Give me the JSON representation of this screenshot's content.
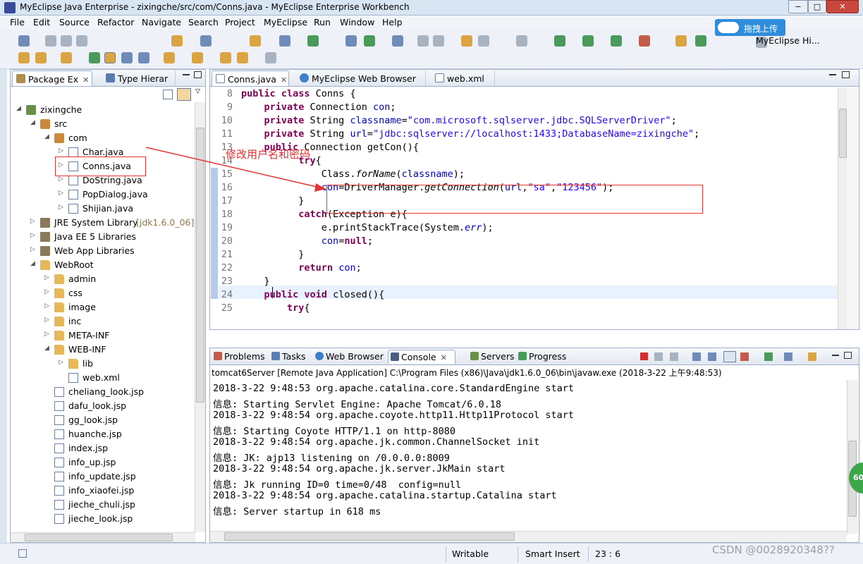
{
  "window": {
    "title": "MyEclipse Java Enterprise - zixingche/src/com/Conns.java - MyEclipse Enterprise Workbench",
    "minimize": "−",
    "maximize": "□",
    "close": "✕"
  },
  "menu": [
    "File",
    "Edit",
    "Source",
    "Refactor",
    "Navigate",
    "Search",
    "Project",
    "MyEclipse",
    "Run",
    "Window",
    "Help"
  ],
  "baidu_widget": {
    "label": "拖拽上传"
  },
  "perspective_hint": "MyEclipse Hi...",
  "left_panel": {
    "tabs": [
      {
        "label": "Package Ex",
        "close": "✕"
      },
      {
        "label": "Type Hierar"
      }
    ],
    "tree": [
      {
        "label": "zixingche",
        "icon": "project-icon",
        "twisty": "◢"
      },
      {
        "label": "src",
        "icon": "source-folder-icon",
        "twisty": "◢"
      },
      {
        "label": "com",
        "icon": "package-icon",
        "twisty": "◢"
      },
      {
        "label": "Char.java",
        "icon": "java-file-icon",
        "twisty": "▷"
      },
      {
        "label": "Conns.java",
        "icon": "java-file-icon",
        "twisty": "▷"
      },
      {
        "label": "DoString.java",
        "icon": "java-file-icon",
        "twisty": "▷"
      },
      {
        "label": "PopDialog.java",
        "icon": "java-file-icon",
        "twisty": "▷"
      },
      {
        "label": "Shijian.java",
        "icon": "java-file-icon",
        "twisty": "▷"
      },
      {
        "label": "JRE System Library",
        "extra": "[jdk1.6.0_06]",
        "icon": "library-icon",
        "twisty": "▷"
      },
      {
        "label": "Java EE 5 Libraries",
        "icon": "library-icon",
        "twisty": "▷"
      },
      {
        "label": "Web App Libraries",
        "icon": "library-icon",
        "twisty": "▷"
      },
      {
        "label": "WebRoot",
        "icon": "webroot-icon",
        "twisty": "◢"
      },
      {
        "label": "admin",
        "icon": "folder-icon",
        "twisty": "▷"
      },
      {
        "label": "css",
        "icon": "folder-icon",
        "twisty": "▷"
      },
      {
        "label": "image",
        "icon": "folder-icon",
        "twisty": "▷"
      },
      {
        "label": "inc",
        "icon": "folder-icon",
        "twisty": "▷"
      },
      {
        "label": "META-INF",
        "icon": "folder-icon",
        "twisty": "▷"
      },
      {
        "label": "WEB-INF",
        "icon": "folder-icon",
        "twisty": "◢"
      },
      {
        "label": "lib",
        "icon": "folder-icon",
        "twisty": "▷"
      },
      {
        "label": "web.xml",
        "icon": "xml-file-icon",
        "twisty": ""
      },
      {
        "label": "cheliang_look.jsp",
        "icon": "jsp-file-icon",
        "twisty": ""
      },
      {
        "label": "dafu_look.jsp",
        "icon": "jsp-file-icon",
        "twisty": ""
      },
      {
        "label": "gg_look.jsp",
        "icon": "jsp-file-icon",
        "twisty": ""
      },
      {
        "label": "huanche.jsp",
        "icon": "jsp-file-icon",
        "twisty": ""
      },
      {
        "label": "index.jsp",
        "icon": "jsp-file-icon",
        "twisty": ""
      },
      {
        "label": "info_up.jsp",
        "icon": "jsp-file-icon",
        "twisty": ""
      },
      {
        "label": "info_update.jsp",
        "icon": "jsp-file-icon",
        "twisty": ""
      },
      {
        "label": "info_xiaofei.jsp",
        "icon": "jsp-file-icon",
        "twisty": ""
      },
      {
        "label": "jieche_chuli.jsp",
        "icon": "jsp-file-icon",
        "twisty": ""
      },
      {
        "label": "jieche_look.jsp",
        "icon": "jsp-file-icon",
        "twisty": ""
      }
    ]
  },
  "editor": {
    "tabs": [
      {
        "label": "Conns.java",
        "close": "✕"
      },
      {
        "label": "MyEclipse Web Browser"
      },
      {
        "label": "web.xml"
      }
    ],
    "lines": [
      {
        "n": "8",
        "parts": [
          [
            "kw",
            "public class "
          ],
          [
            "",
            "Conns {"
          ]
        ]
      },
      {
        "n": "9",
        "parts": [
          [
            "",
            "    "
          ],
          [
            "kw",
            "private "
          ],
          [
            "",
            "Connection "
          ],
          [
            "fd",
            "con"
          ],
          [
            "",
            ";"
          ]
        ]
      },
      {
        "n": "10",
        "parts": [
          [
            "",
            "    "
          ],
          [
            "kw",
            "private "
          ],
          [
            "",
            "String "
          ],
          [
            "fd",
            "classname"
          ],
          [
            "",
            "="
          ],
          [
            "st",
            "\"com.microsoft.sqlserver.jdbc.SQLServerDriver\""
          ],
          [
            "",
            ";"
          ]
        ]
      },
      {
        "n": "11",
        "parts": [
          [
            "",
            "    "
          ],
          [
            "kw",
            "private "
          ],
          [
            "",
            "String "
          ],
          [
            "fd",
            "url"
          ],
          [
            "",
            "="
          ],
          [
            "st",
            "\"jdbc:sqlserver://localhost:1433;DatabaseName=zixingche\""
          ],
          [
            "",
            ";"
          ]
        ]
      },
      {
        "n": "13",
        "parts": [
          [
            "",
            "    "
          ],
          [
            "kw",
            "public "
          ],
          [
            "",
            "Connection getCon(){"
          ]
        ]
      },
      {
        "n": "14",
        "parts": [
          [
            "",
            "          "
          ],
          [
            "kw",
            "try"
          ],
          [
            "",
            "{"
          ]
        ]
      },
      {
        "n": "15",
        "parts": [
          [
            "",
            "              Class."
          ],
          [
            "it",
            "forName"
          ],
          [
            "",
            "("
          ],
          [
            "fd",
            "classname"
          ],
          [
            "",
            ");"
          ]
        ]
      },
      {
        "n": "16",
        "parts": [
          [
            "",
            "              "
          ],
          [
            "fd",
            "con"
          ],
          [
            "",
            "=DriverManager."
          ],
          [
            "it",
            "getConnection"
          ],
          [
            "",
            "("
          ],
          [
            "fd",
            "url"
          ],
          [
            "",
            ","
          ],
          [
            "st",
            "\"sa\""
          ],
          [
            "",
            ","
          ],
          [
            "st",
            "\"123456\""
          ],
          [
            "",
            ");"
          ]
        ]
      },
      {
        "n": "17",
        "parts": [
          [
            "",
            "          }"
          ]
        ]
      },
      {
        "n": "18",
        "parts": [
          [
            "",
            "          "
          ],
          [
            "kw",
            "catch"
          ],
          [
            "",
            "(Exception e){"
          ]
        ]
      },
      {
        "n": "19",
        "parts": [
          [
            "",
            "              e.printStackTrace(System."
          ],
          [
            "fd it",
            "err"
          ],
          [
            "",
            ");"
          ]
        ]
      },
      {
        "n": "20",
        "parts": [
          [
            "",
            "              "
          ],
          [
            "fd",
            "con"
          ],
          [
            "",
            "="
          ],
          [
            "kw",
            "null"
          ],
          [
            "",
            ";"
          ]
        ]
      },
      {
        "n": "21",
        "parts": [
          [
            "",
            "          }"
          ]
        ]
      },
      {
        "n": "22",
        "parts": [
          [
            "",
            "          "
          ],
          [
            "kw",
            "return "
          ],
          [
            "fd",
            "con"
          ],
          [
            "",
            ";"
          ]
        ]
      },
      {
        "n": "23",
        "parts": [
          [
            "",
            "    }"
          ]
        ]
      },
      {
        "n": "24",
        "parts": [
          [
            "",
            "    "
          ],
          [
            "kw",
            "public void "
          ],
          [
            "",
            "closed(){"
          ]
        ]
      },
      {
        "n": "25",
        "parts": [
          [
            "",
            "        "
          ],
          [
            "kw",
            "try"
          ],
          [
            "",
            "{"
          ]
        ]
      }
    ]
  },
  "annotation": {
    "text": "修改用户名和密码"
  },
  "console": {
    "tabs": [
      "Problems",
      "Tasks",
      "Web Browser",
      "Console",
      "Servers",
      "Progress"
    ],
    "description": "tomcat6Server [Remote Java Application] C:\\Program Files (x86)\\Java\\jdk1.6.0_06\\bin\\javaw.exe (2018-3-22 上午9:48:53)",
    "lines": [
      "2018-3-22 9:48:53 org.apache.catalina.core.StandardEngine start",
      "信息: Starting Servlet Engine: Apache Tomcat/6.0.18",
      "2018-3-22 9:48:54 org.apache.coyote.http11.Http11Protocol start",
      "信息: Starting Coyote HTTP/1.1 on http-8080",
      "2018-3-22 9:48:54 org.apache.jk.common.ChannelSocket init",
      "信息: JK: ajp13 listening on /0.0.0.0:8009",
      "2018-3-22 9:48:54 org.apache.jk.server.JkMain start",
      "信息: Jk running ID=0 time=0/48  config=null",
      "2018-3-22 9:48:54 org.apache.catalina.startup.Catalina start",
      "信息: Server startup in 618 ms"
    ]
  },
  "status": {
    "mode": "Writable",
    "insert": "Smart Insert",
    "position": "23 : 6"
  },
  "watermark": "CSDN @0028920348??",
  "badge": "60",
  "colors": {
    "keyword": "#7f0055",
    "string": "#2a00ff",
    "field": "#0000c0",
    "annotation": "#e53232"
  }
}
